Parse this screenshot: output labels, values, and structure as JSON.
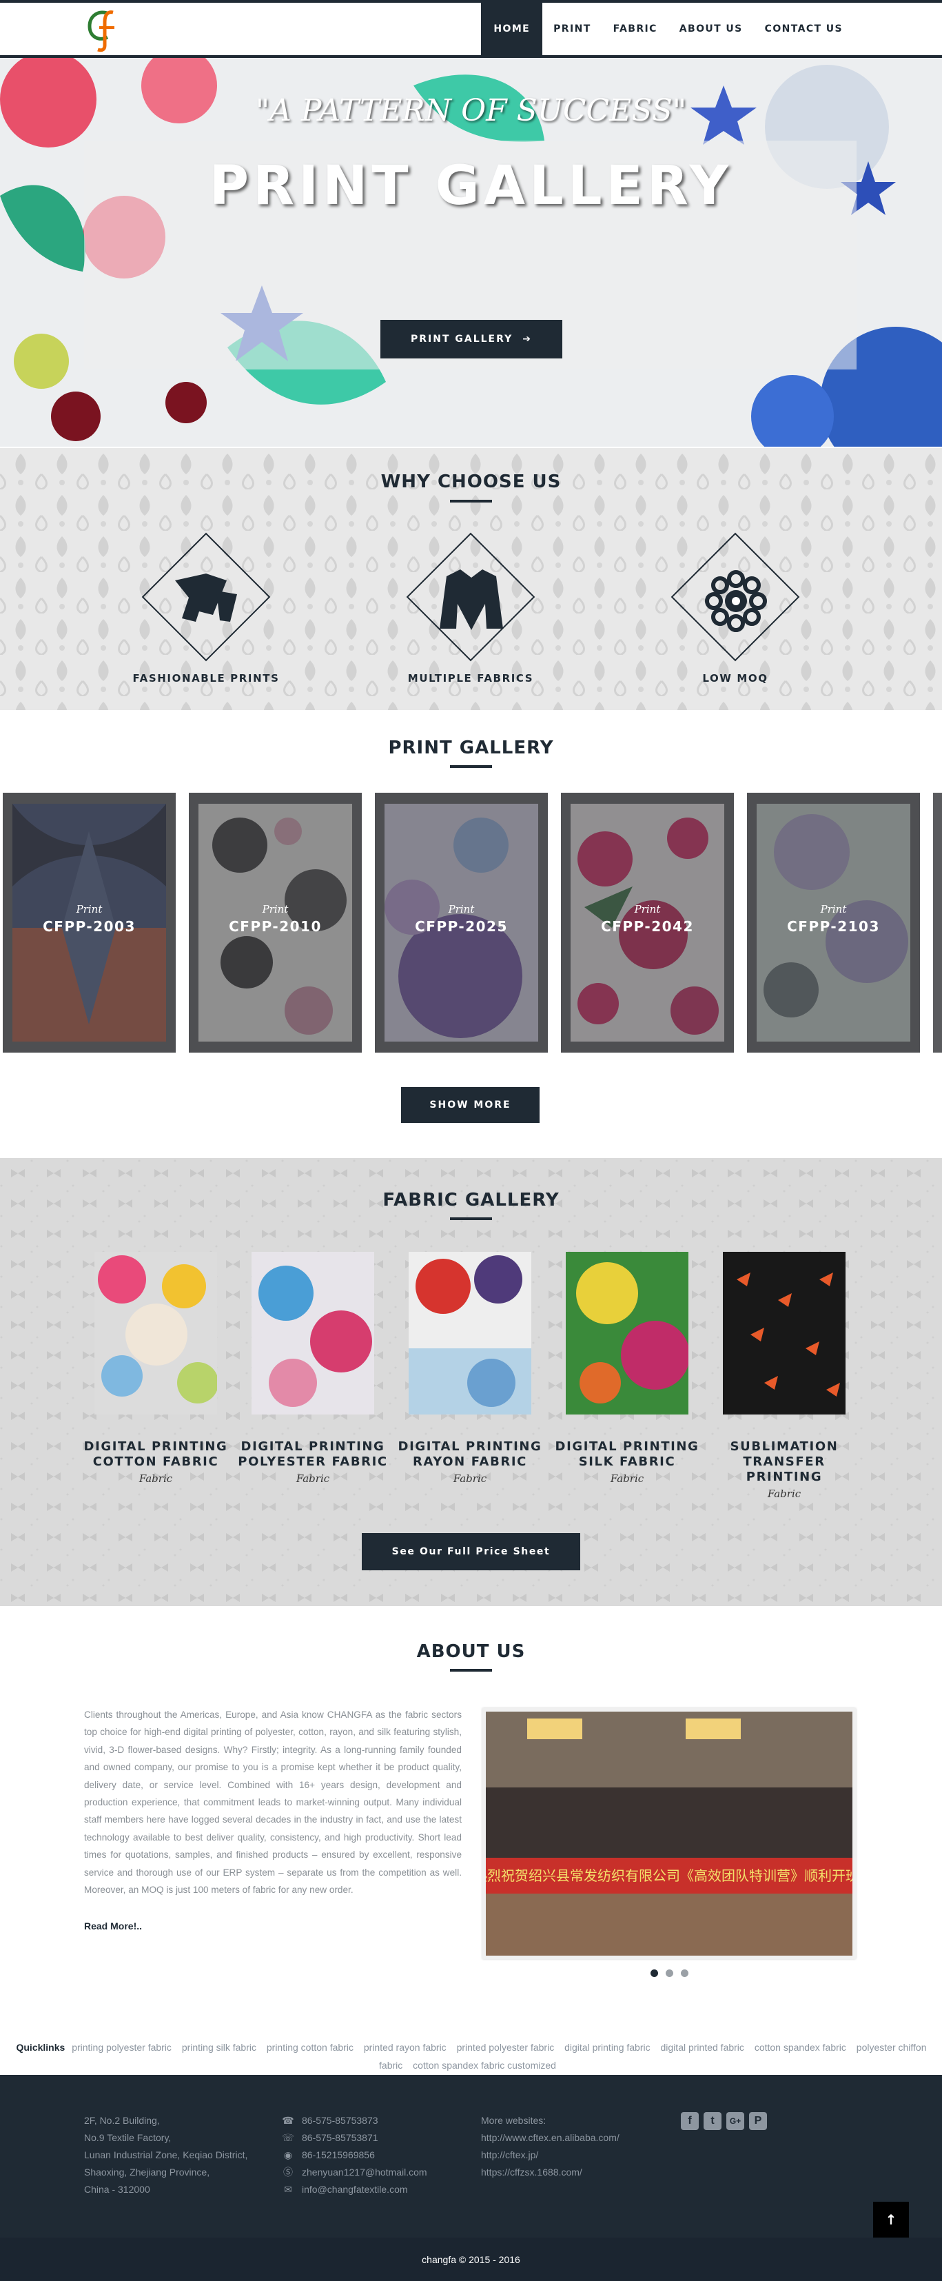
{
  "nav": {
    "items": [
      "HOME",
      "PRINT",
      "FABRIC",
      "ABOUT US",
      "CONTACT US"
    ],
    "active": "HOME",
    "logo_text": "Cf"
  },
  "hero": {
    "quote": "\"A PATTERN OF SUCCESS\"",
    "title": "PRINT GALLERY",
    "button_label": "PRINT GALLERY"
  },
  "why": {
    "title": "WHY CHOOSE US",
    "features": [
      {
        "label": "FASHIONABLE PRINTS",
        "icon": "scarf-icon"
      },
      {
        "label": "MULTIPLE FABRICS",
        "icon": "jacket-icon"
      },
      {
        "label": "LOW MOQ",
        "icon": "rolls-icon"
      }
    ]
  },
  "print_gallery": {
    "title": "PRINT GALLERY",
    "items": [
      {
        "kind": "Print",
        "code": "CFPP-2003"
      },
      {
        "kind": "Print",
        "code": "CFPP-2010"
      },
      {
        "kind": "Print",
        "code": "CFPP-2025"
      },
      {
        "kind": "Print",
        "code": "CFPP-2042"
      },
      {
        "kind": "Print",
        "code": "CFPP-2103"
      }
    ],
    "show_more": "SHOW MORE"
  },
  "fabric_gallery": {
    "title": "FABRIC GALLERY",
    "items": [
      {
        "name_line1": "DIGITAL PRINTING",
        "name_line2": "COTTON FABRIC",
        "name_line3": "",
        "kind": "Fabric"
      },
      {
        "name_line1": "DIGITAL PRINTING",
        "name_line2": "POLYESTER FABRIC",
        "name_line3": "",
        "kind": "Fabric"
      },
      {
        "name_line1": "DIGITAL PRINTING",
        "name_line2": "RAYON FABRIC",
        "name_line3": "",
        "kind": "Fabric"
      },
      {
        "name_line1": "DIGITAL PRINTING",
        "name_line2": "SILK FABRIC",
        "name_line3": "",
        "kind": "Fabric"
      },
      {
        "name_line1": "SUBLIMATION",
        "name_line2": "TRANSFER",
        "name_line3": "PRINTING",
        "kind": "Fabric"
      }
    ],
    "price_button": "See Our Full Price Sheet"
  },
  "about": {
    "title": "ABOUT US",
    "paragraph": "Clients throughout the Americas, Europe, and Asia know CHANGFA as the fabric sectors top choice for high-end digital printing of polyester, cotton, rayon, and silk featuring stylish, vivid, 3-D flower-based designs. Why? Firstly; integrity. As a long-running family founded and owned company, our promise to you is a promise kept whether it be product quality, delivery date, or service level. Combined with 16+ years design, development and production experience, that commitment leads to market-winning output. Many individual staff members here have logged several decades in the industry in fact, and use the latest technology available to best deliver quality, consistency, and high productivity. Short lead times for quotations, samples, and finished products – ensured by excellent, responsive service and thorough use of our ERP system – separate us from the competition as well. Moreover, an MOQ is just 100 meters of fabric for any new order.",
    "read_more": "Read More!..",
    "banner_text": "热烈祝贺绍兴县常发纺织有限公司《高效团队特训营》顺利开班!"
  },
  "quicklinks": {
    "title": "Quicklinks",
    "links": [
      "printing polyester fabric",
      "printing silk fabric",
      "printing cotton fabric",
      "printed rayon fabric",
      "printed polyester fabric",
      "digital printing fabric",
      "digital printed fabric",
      "cotton spandex fabric",
      "polyester chiffon fabric",
      "cotton spandex fabric customized"
    ]
  },
  "footer": {
    "address": [
      "2F, No.2 Building,",
      "No.9 Textile Factory,",
      "Lunan Industrial Zone, Keqiao District,",
      "Shaoxing, Zhejiang Province,",
      "China - 312000"
    ],
    "contacts": [
      {
        "icon": "phone-icon",
        "text": "86-575-85753873"
      },
      {
        "icon": "fax-icon",
        "text": "86-575-85753871"
      },
      {
        "icon": "whatsapp-icon",
        "text": "86-15215969856"
      },
      {
        "icon": "skype-icon",
        "text": "zhenyuan1217@hotmail.com"
      },
      {
        "icon": "mail-icon",
        "text": "info@changfatextile.com"
      }
    ],
    "websites_title": "More websites:",
    "websites": [
      "http://www.cftex.en.alibaba.com/",
      "http://cftex.jp/",
      "https://cffzsx.1688.com/"
    ],
    "social": [
      "f",
      "t",
      "G+",
      "P"
    ],
    "copyright": "changfa © 2015 - 2016"
  },
  "colors": {
    "navy": "#1f2a34",
    "muted_text": "#8d96a0",
    "logo_green": "#2e7d32",
    "logo_orange": "#ef6c00"
  }
}
